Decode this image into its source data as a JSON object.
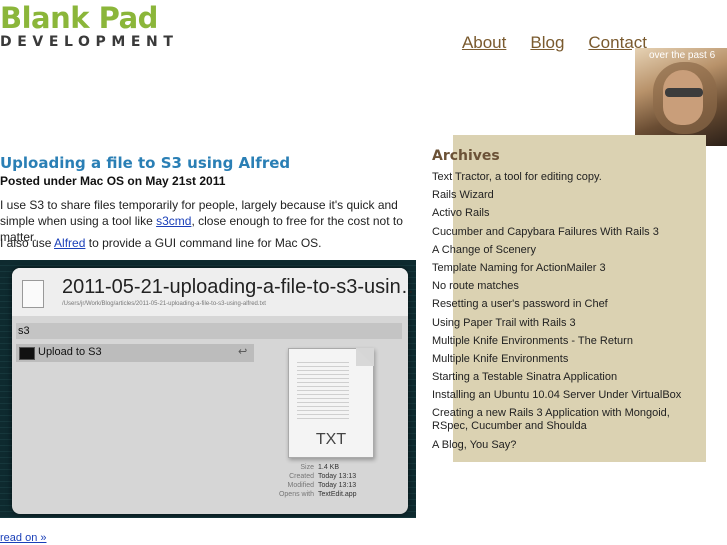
{
  "header": {
    "logo_line1": "Blank Pad",
    "logo_line2": "DEVELOPMENT",
    "nav": [
      "About",
      "Blog",
      "Contact"
    ],
    "photo_caption": "over the past 6"
  },
  "post": {
    "title": "Uploading a file to S3 using Alfred",
    "meta": "Posted under Mac OS on May 21st 2011",
    "p1_before": "I use S3 to share files temporarily for people, largely because it's quick and simple when using a tool like ",
    "p1_link": "s3cmd",
    "p1_after": ", close enough to free for the cost not to matter.",
    "p2_before": "I also use ",
    "p2_link": "Alfred",
    "p2_after": " to provide a GUI command line for Mac OS.",
    "read_on": "read on »"
  },
  "screenshot": {
    "title": "2011-05-21-uploading-a-file-to-s3-usin…",
    "path": "/Users/jr/Work/Blog/articles/2011-05-21-uploading-a-file-to-s3-using-alfred.txt",
    "input": "s3",
    "row_label": "Upload to S3",
    "return_glyph": "↩",
    "doc_label": "TXT",
    "meta": [
      {
        "k": "Size",
        "v": "1.4 KB"
      },
      {
        "k": "Created",
        "v": "Today 13:13"
      },
      {
        "k": "Modified",
        "v": "Today 13:13"
      },
      {
        "k": "Opens with",
        "v": "TextEdit.app"
      }
    ]
  },
  "sidebar": {
    "title": "Archives",
    "items": [
      "Text Tractor, a tool for editing copy.",
      "Rails Wizard",
      "Activo Rails",
      "Cucumber and Capybara Failures With Rails 3",
      "A Change of Scenery",
      "Template Naming for ActionMailer 3",
      "No route matches",
      "Resetting a user's password in Chef",
      "Using Paper Trail with Rails 3",
      "Multiple Knife Environments - The Return",
      "Multiple Knife Environments",
      "Starting a Testable Sinatra Application",
      "Installing an Ubuntu 10.04 Server Under VirtualBox",
      "Creating a new Rails 3 Application with Mongoid, RSpec, Cucumber and Shoulda",
      "A Blog, You Say?"
    ]
  },
  "colors": {
    "logo_green": "#8bb63a",
    "link_brown": "#7a5a2e",
    "title_blue": "#2a7fb5",
    "sidebar_bg": "#dbd2b2"
  }
}
